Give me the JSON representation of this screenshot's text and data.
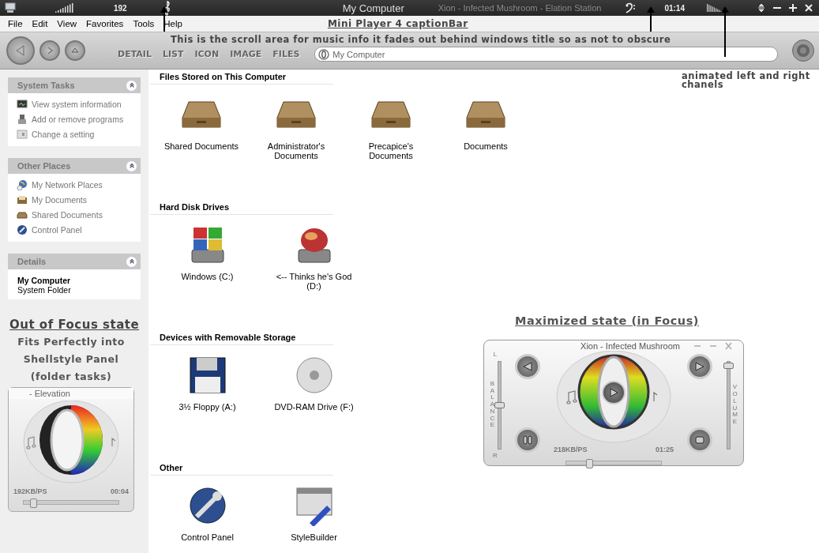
{
  "caption_bar": {
    "bitrate": "192",
    "window_title": "My Computer",
    "track_info": "Xion - Infected Mushroom - Elation Station",
    "time": "01:14"
  },
  "menu_bar": {
    "items": [
      "File",
      "Edit",
      "View",
      "Favorites",
      "Tools",
      "Help"
    ]
  },
  "toolbar": {
    "view_tabs": [
      "DETAIL",
      "LIST",
      "ICON",
      "IMAGE",
      "FILES"
    ],
    "address": "My Computer"
  },
  "annotations": {
    "caption_bar": "Mini Player 4 captionBar",
    "scroll_area": "This is the scroll area for music info it fades out behind windows title so as not to obscure",
    "channels": "animated left and right chanels",
    "out_of_focus_title": "Out of Focus state",
    "out_of_focus_note": "Fits Perfectly into Shellstyle Panel (folder tasks)",
    "maximized_title": "Maximized state (in Focus)"
  },
  "sidebar": {
    "panels": [
      {
        "title": "System Tasks",
        "kind": "links",
        "items": [
          {
            "label": "View system information",
            "kind": "info"
          },
          {
            "label": "Add or remove programs",
            "kind": "programs"
          },
          {
            "label": "Change a setting",
            "kind": "setting"
          }
        ]
      },
      {
        "title": "Other Places",
        "kind": "links",
        "items": [
          {
            "label": "My Network Places",
            "kind": "network"
          },
          {
            "label": "My Documents",
            "kind": "documents"
          },
          {
            "label": "Shared Documents",
            "kind": "folder"
          },
          {
            "label": "Control Panel",
            "kind": "control-panel"
          }
        ]
      },
      {
        "title": "Details",
        "kind": "details",
        "name": "My Computer",
        "description": "System Folder"
      }
    ]
  },
  "sections": [
    {
      "title": "Files Stored on This Computer",
      "items": [
        {
          "label": "Shared Documents",
          "kind": "folder"
        },
        {
          "label": "Administrator's Documents",
          "kind": "folder"
        },
        {
          "label": "Precapice's Documents",
          "kind": "folder"
        },
        {
          "label": "Documents",
          "kind": "folder"
        }
      ]
    },
    {
      "title": "Hard Disk Drives",
      "items": [
        {
          "label": "Windows (C:)",
          "kind": "system-drive"
        },
        {
          "label": "<-- Thinks he's God (D:)",
          "kind": "drive"
        }
      ]
    },
    {
      "title": "Devices with Removable Storage",
      "items": [
        {
          "label": "3½ Floppy (A:)",
          "kind": "floppy"
        },
        {
          "label": "DVD-RAM Drive (F:)",
          "kind": "optical"
        }
      ]
    },
    {
      "title": "Other",
      "items": [
        {
          "label": "Control Panel",
          "kind": "control-panel"
        },
        {
          "label": "StyleBuilder",
          "kind": "app"
        }
      ]
    }
  ],
  "mini_player": {
    "title": "- Elevation",
    "bitrate": "192KB/PS",
    "time": "00:04",
    "seek": {
      "level": 0.1
    }
  },
  "maximized_player": {
    "title": "Xion - Infected Mushroom",
    "bitrate": "218KB/PS",
    "time": "01:25",
    "balance": {
      "top": "L",
      "bottom": "R",
      "label": "BALANCE",
      "level": 0.5
    },
    "volume": {
      "label": "VOLUME",
      "level": 0.95
    },
    "seek": {
      "level": 0.24
    }
  }
}
